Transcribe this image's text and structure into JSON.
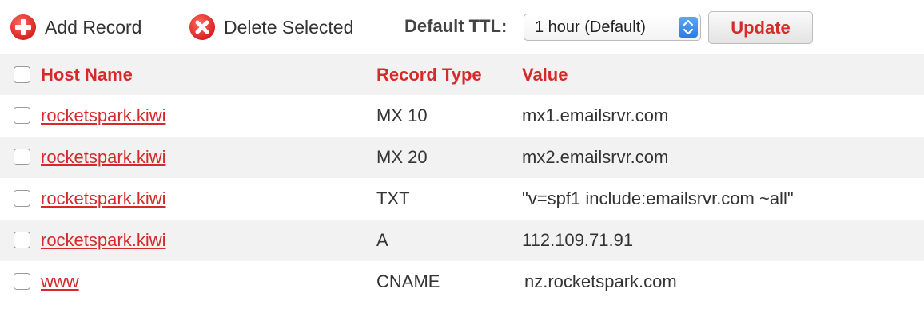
{
  "toolbar": {
    "add_label": "Add Record",
    "delete_label": "Delete Selected",
    "ttl_label": "Default TTL:",
    "ttl_selected": "1 hour (Default)",
    "update_label": "Update"
  },
  "table": {
    "headers": {
      "host": "Host Name",
      "type": "Record Type",
      "value": "Value"
    },
    "rows": [
      {
        "host": "rocketspark.kiwi",
        "type": "MX 10",
        "value": "mx1.emailsrvr.com"
      },
      {
        "host": "rocketspark.kiwi",
        "type": "MX 20",
        "value": "mx2.emailsrvr.com"
      },
      {
        "host": "rocketspark.kiwi",
        "type": "TXT",
        "value": "\"v=spf1 include:emailsrvr.com ~all\""
      },
      {
        "host": "rocketspark.kiwi",
        "type": "A",
        "value": "112.109.71.91"
      },
      {
        "host": "www",
        "type": "CNAME",
        "value": "nz.rocketspark.com"
      }
    ]
  },
  "colors": {
    "accent": "#d62a2a",
    "stripe": "#f2f2f2",
    "select_arrow": "#2b7ce9"
  },
  "icons": {
    "add": "plus-circle-icon",
    "delete": "x-circle-icon",
    "select": "updown-arrows-icon"
  }
}
